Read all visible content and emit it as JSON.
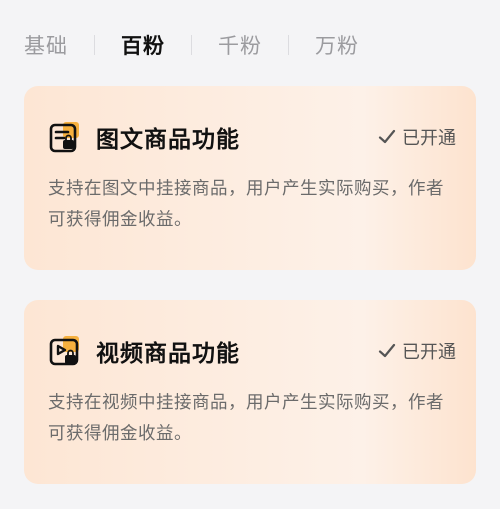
{
  "tabs": [
    {
      "label": "基础",
      "active": false
    },
    {
      "label": "百粉",
      "active": true
    },
    {
      "label": "千粉",
      "active": false
    },
    {
      "label": "万粉",
      "active": false
    }
  ],
  "cards": [
    {
      "icon": "image-text-product-icon",
      "title": "图文商品功能",
      "status": "已开通",
      "description": "支持在图文中挂接商品，用户产生实际购买，作者可获得佣金收益。"
    },
    {
      "icon": "video-product-icon",
      "title": "视频商品功能",
      "status": "已开通",
      "description": "支持在视频中挂接商品，用户产生实际购买，作者可获得佣金收益。"
    }
  ],
  "colors": {
    "accent": "#f5a623",
    "card_bg": "#fdece0",
    "page_bg": "#f4f4f6"
  }
}
